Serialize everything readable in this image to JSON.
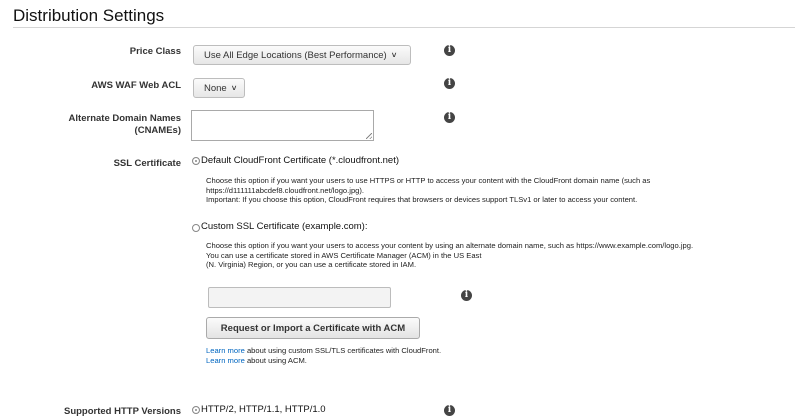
{
  "page": {
    "title": "Distribution Settings"
  },
  "price_class": {
    "label": "Price Class",
    "selected": "Use All Edge Locations (Best Performance)",
    "info_icon": "info-icon"
  },
  "waf": {
    "label": "AWS WAF Web ACL",
    "selected": "None",
    "info_icon": "info-icon"
  },
  "cnames": {
    "label_line1": "Alternate Domain Names",
    "label_line2": "(CNAMEs)",
    "value": "",
    "info_icon": "info-icon"
  },
  "ssl": {
    "label": "SSL Certificate",
    "default_option": "Default CloudFront Certificate (*.cloudfront.net)",
    "default_desc_line1": "Choose this option if you want your users to use HTTPS or HTTP to access your content with the CloudFront domain name (such as",
    "default_desc_line2": "https://d111111abcdef8.cloudfront.net/logo.jpg).",
    "default_desc_line3": "Important: If you choose this option, CloudFront requires that browsers or devices support TLSv1 or later to access your content.",
    "custom_option": "Custom SSL Certificate (example.com):",
    "custom_desc_line1": "Choose this option if you want your users to access your content by using an alternate domain name, such as https://www.example.com/logo.jpg.",
    "custom_desc_line2": "You can use a certificate stored in AWS Certificate Manager (ACM) in the US East",
    "custom_desc_line3": "(N. Virginia) Region, or you can use a certificate stored in IAM.",
    "certificate_value": "",
    "request_button": "Request or Import a Certificate with ACM",
    "learn_more_1_link": "Learn more",
    "learn_more_1_text": " about using custom SSL/TLS certificates with CloudFront.",
    "learn_more_2_link": "Learn more",
    "learn_more_2_text": " about using ACM."
  },
  "http_versions": {
    "label": "Supported HTTP Versions",
    "option": "HTTP/2, HTTP/1.1, HTTP/1.0"
  }
}
